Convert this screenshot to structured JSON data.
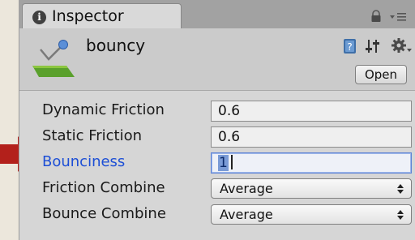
{
  "tab": {
    "title": "Inspector",
    "info_icon_glyph": "i"
  },
  "asset": {
    "name": "bouncy",
    "icon": "physic-material-icon",
    "open_label": "Open"
  },
  "properties": [
    {
      "label": "Dynamic Friction",
      "value": "0.6",
      "kind": "float"
    },
    {
      "label": "Static Friction",
      "value": "0.6",
      "kind": "float"
    },
    {
      "label": "Bounciness",
      "value": "1",
      "kind": "float",
      "focused": true
    },
    {
      "label": "Friction Combine",
      "value": "Average",
      "kind": "enum"
    },
    {
      "label": "Bounce Combine",
      "value": "Average",
      "kind": "enum"
    }
  ],
  "colors": {
    "active_label": "#1d4fd6",
    "pointer_arrow": "#b3201b",
    "selection": "#7a9bd6"
  }
}
